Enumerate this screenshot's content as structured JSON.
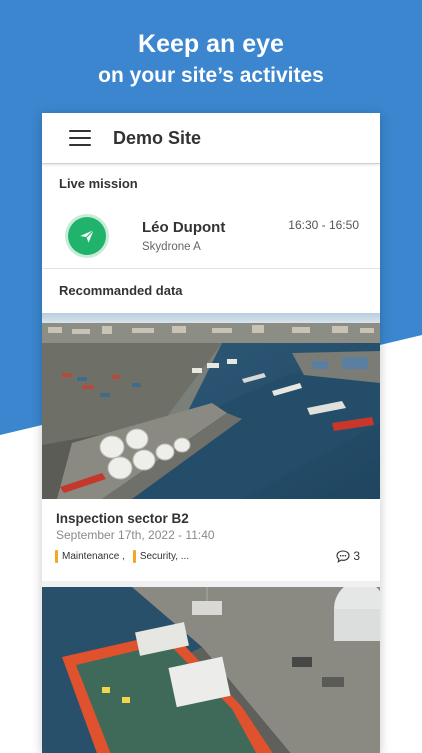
{
  "headline": {
    "line1": "Keep an eye",
    "line2": "on your site’s activites"
  },
  "appbar": {
    "title": "Demo Site",
    "menu_icon": "hamburger-menu-icon"
  },
  "live_mission": {
    "section_label": "Live mission",
    "pilot_name": "Léo Dupont",
    "drone_name": "Skydrone A",
    "time_range": "16:30 - 16:50",
    "avatar_icon": "send-plane-icon",
    "avatar_color": "#20b36b"
  },
  "recommended": {
    "section_label": "Recommanded data",
    "cards": [
      {
        "title": "Inspection sector B2",
        "date": "September 17th, 2022 - 11:40",
        "tags": [
          "Maintenance ,",
          "Security, ..."
        ],
        "comment_count": "3"
      }
    ]
  },
  "colors": {
    "brand_blue": "#3b86cf",
    "tag_accent": "#f5a623"
  }
}
